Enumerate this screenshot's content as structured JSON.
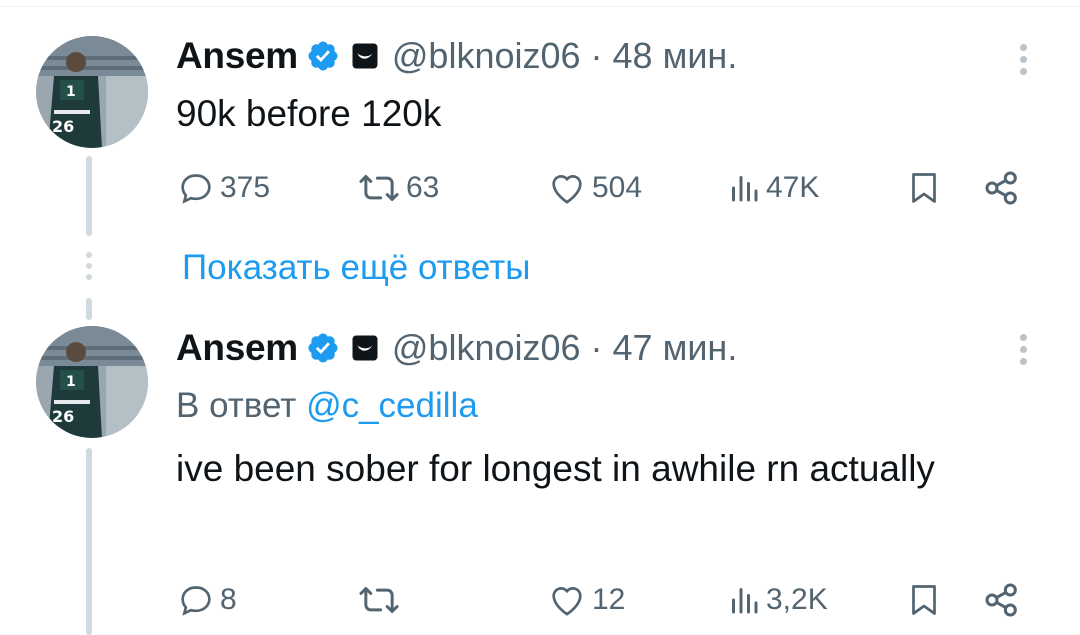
{
  "tweets": [
    {
      "author_name": "Ansem",
      "handle_time": "@blknoiz06 · 48 мин.",
      "reply_prefix": "",
      "reply_mention": "",
      "text": "90k before 120k",
      "replies": "375",
      "retweets": "63",
      "likes": "504",
      "views": "47K"
    },
    {
      "author_name": "Ansem",
      "handle_time": "@blknoiz06 · 47 мин.",
      "reply_prefix": "В ответ ",
      "reply_mention": "@c_cedilla",
      "text": "ive been sober for longest in awhile rn actually",
      "replies": "8",
      "retweets": "",
      "likes": "12",
      "views": "3,2K"
    }
  ],
  "show_more_replies": "Показать ещё ответы",
  "colors": {
    "link": "#1d9bf0",
    "muted": "#536471",
    "verified": "#1d9bf0"
  },
  "icons": [
    "verified-badge-icon",
    "affiliate-badge-icon",
    "more-icon",
    "reply-icon",
    "retweet-icon",
    "like-icon",
    "views-icon",
    "bookmark-icon",
    "share-icon"
  ]
}
